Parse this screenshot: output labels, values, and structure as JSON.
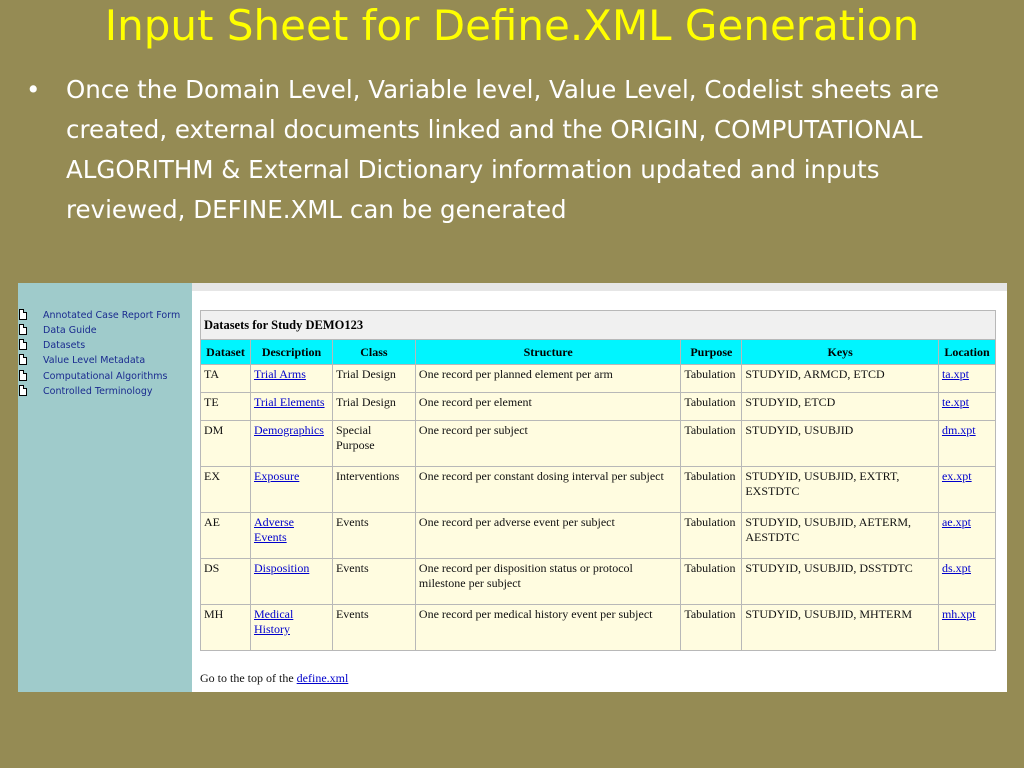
{
  "slide": {
    "title": "Input Sheet for Define.XML Generation",
    "bullet_symbol": "•",
    "bullet_text": "Once the Domain Level, Variable level, Value Level, Codelist sheets are created, external documents linked and the ORIGIN, COMPUTATIONAL ALGORITHM & External Dictionary information updated and inputs reviewed, DEFINE.XML can be generated"
  },
  "sidebar": {
    "items": [
      {
        "label": "Annotated Case Report Form"
      },
      {
        "label": "Data Guide"
      },
      {
        "label": "Datasets"
      },
      {
        "label": "Value Level Metadata"
      },
      {
        "label": "Computational Algorithms"
      },
      {
        "label": "Controlled Terminology"
      }
    ]
  },
  "table": {
    "caption": "Datasets for Study DEMO123",
    "headers": [
      "Dataset",
      "Description",
      "Class",
      "Structure",
      "Purpose",
      "Keys",
      "Location"
    ],
    "rows": [
      {
        "dataset": "TA",
        "description": "Trial Arms",
        "class": "Trial Design",
        "structure": "One record per planned element per arm",
        "purpose": "Tabulation",
        "keys": "STUDYID, ARMCD, ETCD",
        "location": "ta.xpt"
      },
      {
        "dataset": "TE",
        "description": "Trial Elements",
        "class": "Trial Design",
        "structure": "One record per element",
        "purpose": "Tabulation",
        "keys": "STUDYID, ETCD",
        "location": "te.xpt"
      },
      {
        "dataset": "DM",
        "description": "Demographics",
        "class": "Special Purpose",
        "structure": "One record per subject",
        "purpose": "Tabulation",
        "keys": "STUDYID, USUBJID",
        "location": "dm.xpt"
      },
      {
        "dataset": "EX",
        "description": "Exposure",
        "class": "Interventions",
        "structure": "One record per constant dosing interval per subject",
        "purpose": "Tabulation",
        "keys": "STUDYID, USUBJID, EXTRT, EXSTDTC",
        "location": "ex.xpt"
      },
      {
        "dataset": "AE",
        "description": "Adverse Events",
        "class": "Events",
        "structure": "One record per adverse event per subject",
        "purpose": "Tabulation",
        "keys": "STUDYID, USUBJID, AETERM, AESTDTC",
        "location": "ae.xpt"
      },
      {
        "dataset": "DS",
        "description": "Disposition",
        "class": "Events",
        "structure": "One record per disposition status or protocol milestone per subject",
        "purpose": "Tabulation",
        "keys": "STUDYID, USUBJID, DSSTDTC",
        "location": "ds.xpt"
      },
      {
        "dataset": "MH",
        "description": "Medical History",
        "class": "Events",
        "structure": "One record per medical history event per subject",
        "purpose": "Tabulation",
        "keys": "STUDYID, USUBJID, MHTERM",
        "location": "mh.xpt"
      }
    ]
  },
  "footer": {
    "prefix": "Go to the top of the ",
    "link_text": "define.xml"
  },
  "colors": {
    "slide_background": "#958b54",
    "title": "#ffff00",
    "sidebar_background": "#9fcbcb",
    "header_background": "#00f5ff",
    "row_background": "#fffce0",
    "link": "#0000cc"
  }
}
